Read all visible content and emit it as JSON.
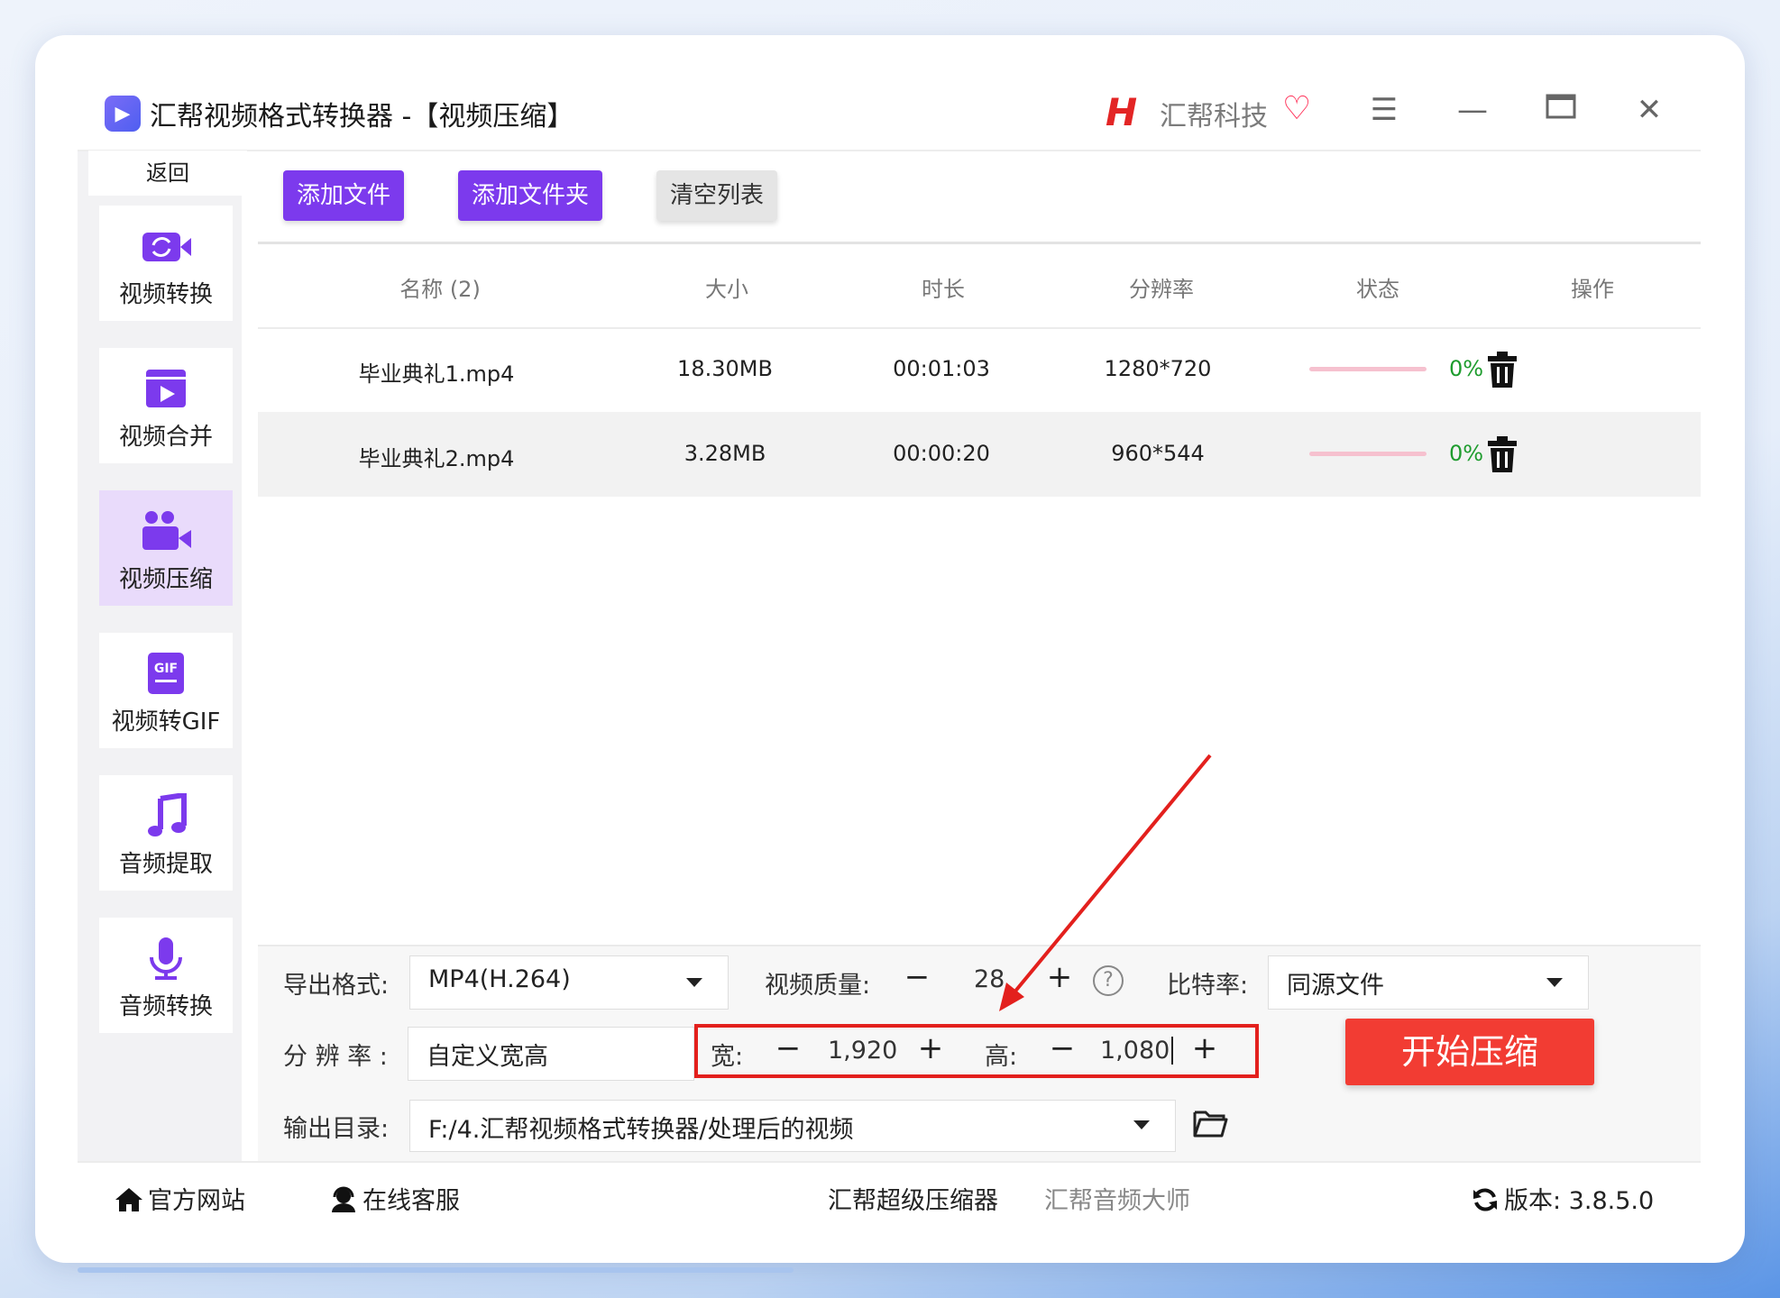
{
  "window": {
    "app_title": "汇帮视频格式转换器  -【视频压缩】",
    "brand_name": "汇帮科技",
    "brand_mark": "H",
    "icons": [
      "app-logo-icon",
      "menu-icon",
      "minimize-icon",
      "maximize-icon",
      "close-icon"
    ]
  },
  "sidebar": {
    "back_label": "返回",
    "items": [
      {
        "label": "视频转换",
        "icon": "video-convert-icon"
      },
      {
        "label": "视频合并",
        "icon": "video-merge-icon"
      },
      {
        "label": "视频压缩",
        "icon": "video-compress-icon",
        "active": true
      },
      {
        "label": "视频转GIF",
        "icon": "gif-icon"
      },
      {
        "label": "音频提取",
        "icon": "music-note-icon"
      },
      {
        "label": "音频转换",
        "icon": "microphone-icon"
      }
    ]
  },
  "toolbar": {
    "add_file": "添加文件",
    "add_folder": "添加文件夹",
    "clear_list": "清空列表"
  },
  "table": {
    "headers": [
      "名称 (2)",
      "大小",
      "时长",
      "分辨率",
      "状态",
      "操作"
    ],
    "rows": [
      {
        "name": "毕业典礼1.mp4",
        "size": "18.30MB",
        "duration": "00:01:03",
        "resolution": "1280*720",
        "progress": 0,
        "percent": "0%"
      },
      {
        "name": "毕业典礼2.mp4",
        "size": "3.28MB",
        "duration": "00:00:20",
        "resolution": "960*544",
        "progress": 0,
        "percent": "0%"
      }
    ]
  },
  "settings": {
    "format_label": "导出格式:",
    "format_value": "MP4(H.264)",
    "quality_label": "视频质量:",
    "quality_value": "28",
    "bitrate_label": "比特率:",
    "bitrate_value": "同源文件",
    "resolution_label": "分 辨 率 :",
    "resolution_value": "自定义宽高",
    "width_label": "宽:",
    "width_value": "1,920",
    "height_label": "高:",
    "height_value": "1,080",
    "output_label": "输出目录:",
    "output_value": "F:/4.汇帮视频格式转换器/处理后的视频",
    "minus": "−",
    "plus": "+",
    "help": "?"
  },
  "start_button": "开始压缩",
  "footer": {
    "website": "官方网站",
    "support": "在线客服",
    "compressor": "汇帮超级压缩器",
    "audio_master": "汇帮音频大师",
    "version": "版本: 3.8.5.0"
  },
  "colors": {
    "accent_purple": "#7c3aed",
    "start_red": "#f23c33",
    "highlight_red": "#e3201d",
    "success_green": "#1e9c2e",
    "progress_track": "#f6c1cf"
  }
}
